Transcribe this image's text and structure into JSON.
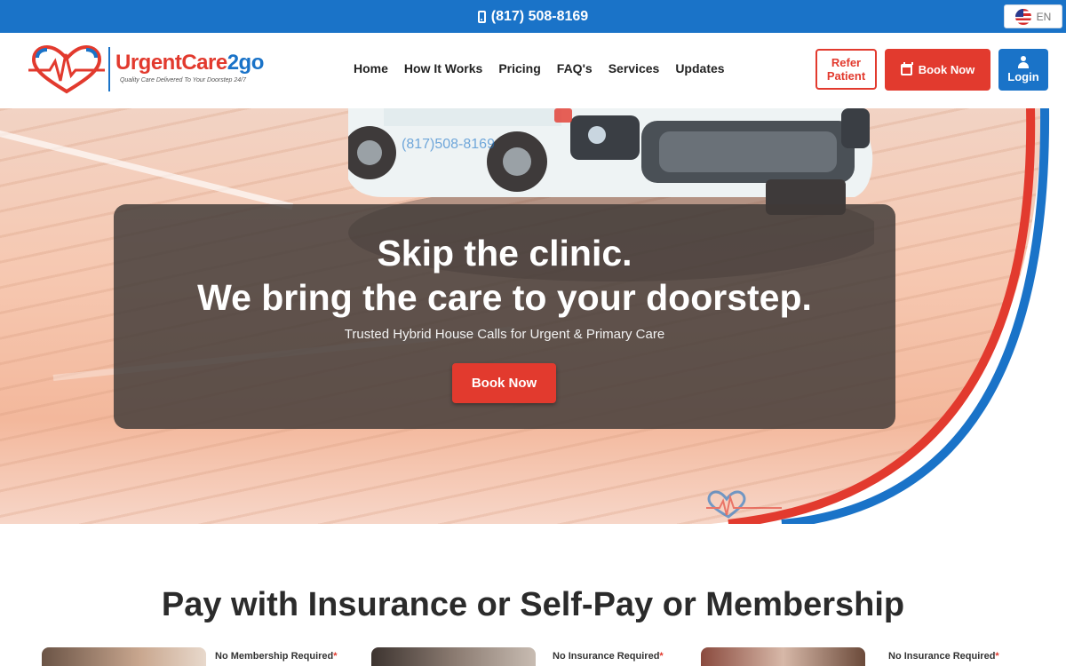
{
  "topbar": {
    "phone": "(817) 508-8169",
    "language": "EN"
  },
  "logo": {
    "name_part1": "UrgentCare",
    "name_part2": "2go",
    "tagline": "Quality Care Delivered To Your Doorstep 24/7"
  },
  "nav": {
    "items": [
      {
        "label": "Home"
      },
      {
        "label": "How It Works"
      },
      {
        "label": "Pricing"
      },
      {
        "label": "FAQ's"
      },
      {
        "label": "Services"
      },
      {
        "label": "Updates"
      }
    ]
  },
  "header_actions": {
    "refer_label": "Refer Patient",
    "book_label": "Book Now",
    "login_label": "Login"
  },
  "hero": {
    "title_line1": "Skip the clinic.",
    "title_line2": "We bring the care to your doorstep.",
    "subtitle": "Trusted Hybrid House Calls for Urgent & Primary Care",
    "cta_label": "Book Now"
  },
  "payment": {
    "title": "Pay with Insurance or Self-Pay or Membership",
    "cards": [
      {
        "label": "No Membership Required",
        "star": "*"
      },
      {
        "label": "No Insurance Required",
        "star": "*"
      },
      {
        "label": "No Insurance Required",
        "star": "*"
      }
    ]
  },
  "colors": {
    "brand_blue": "#1a73c8",
    "brand_red": "#e23a2e"
  }
}
